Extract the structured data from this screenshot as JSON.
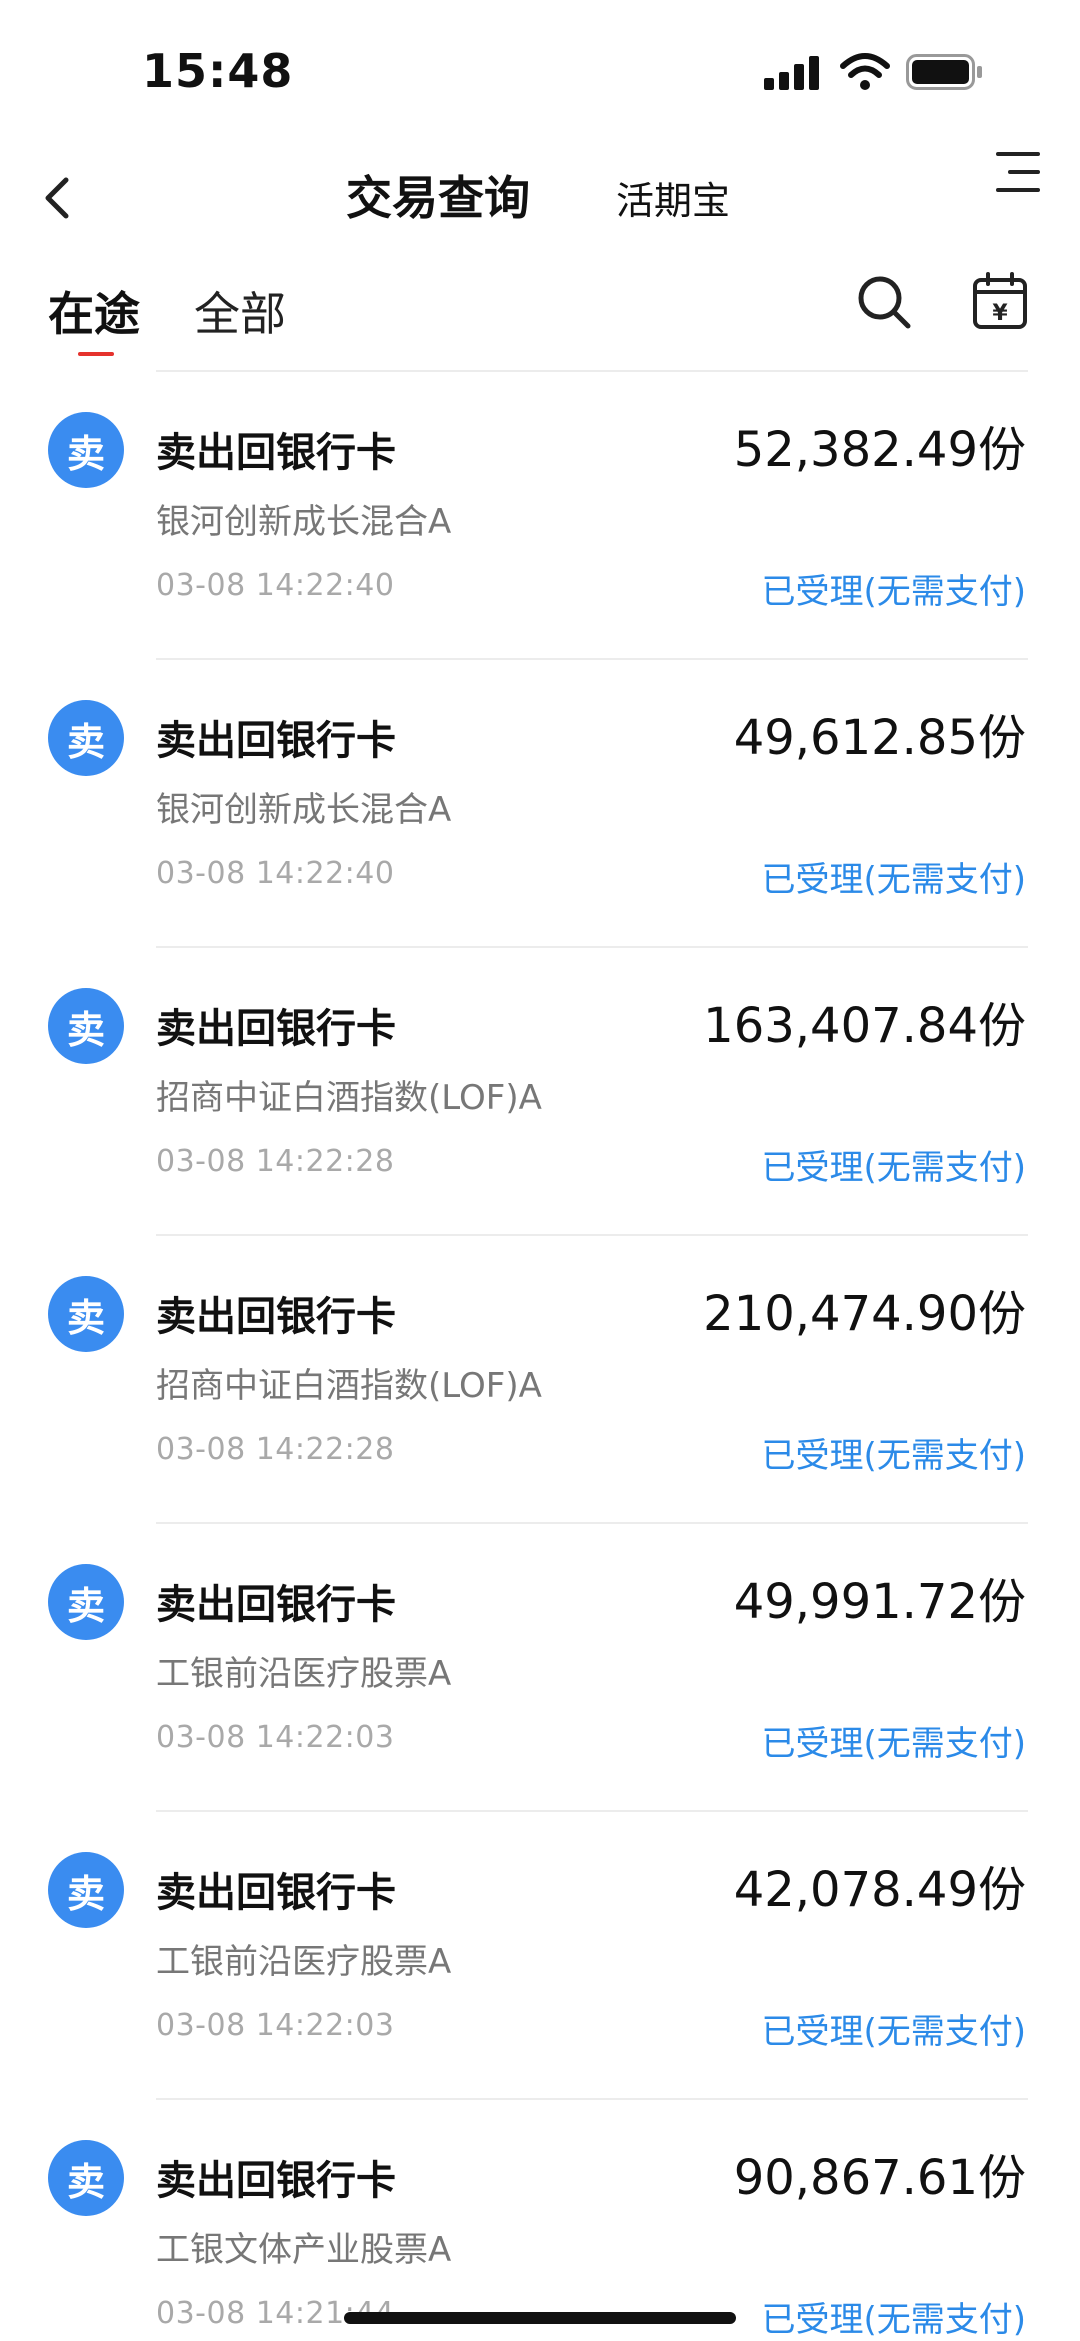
{
  "status_bar": {
    "time": "15:48"
  },
  "nav": {
    "title": "交易查询",
    "subtitle": "活期宝"
  },
  "tabs": [
    {
      "label": "在途"
    },
    {
      "label": "全部"
    }
  ],
  "records": [
    {
      "avatar": "卖",
      "title": "卖出回银行卡",
      "amount": "52,382.49份",
      "fund": "银河创新成长混合A",
      "time": "03-08 14:22:40",
      "status": "已受理(无需支付)"
    },
    {
      "avatar": "卖",
      "title": "卖出回银行卡",
      "amount": "49,612.85份",
      "fund": "银河创新成长混合A",
      "time": "03-08 14:22:40",
      "status": "已受理(无需支付)"
    },
    {
      "avatar": "卖",
      "title": "卖出回银行卡",
      "amount": "163,407.84份",
      "fund": "招商中证白酒指数(LOF)A",
      "time": "03-08 14:22:28",
      "status": "已受理(无需支付)"
    },
    {
      "avatar": "卖",
      "title": "卖出回银行卡",
      "amount": "210,474.90份",
      "fund": "招商中证白酒指数(LOF)A",
      "time": "03-08 14:22:28",
      "status": "已受理(无需支付)"
    },
    {
      "avatar": "卖",
      "title": "卖出回银行卡",
      "amount": "49,991.72份",
      "fund": "工银前沿医疗股票A",
      "time": "03-08 14:22:03",
      "status": "已受理(无需支付)"
    },
    {
      "avatar": "卖",
      "title": "卖出回银行卡",
      "amount": "42,078.49份",
      "fund": "工银前沿医疗股票A",
      "time": "03-08 14:22:03",
      "status": "已受理(无需支付)"
    },
    {
      "avatar": "卖",
      "title": "卖出回银行卡",
      "amount": "90,867.61份",
      "fund": "工银文体产业股票A",
      "time": "03-08 14:21:44",
      "status": "已受理(无需支付)"
    }
  ],
  "colors": {
    "accent_blue": "#2b8ae8",
    "avatar_blue": "#3a8cf0",
    "tab_indicator_red": "#e5322d"
  },
  "icons": [
    "back-icon",
    "menu-icon",
    "search-icon",
    "calendar-icon",
    "signal-icon",
    "wifi-icon",
    "battery-icon"
  ]
}
